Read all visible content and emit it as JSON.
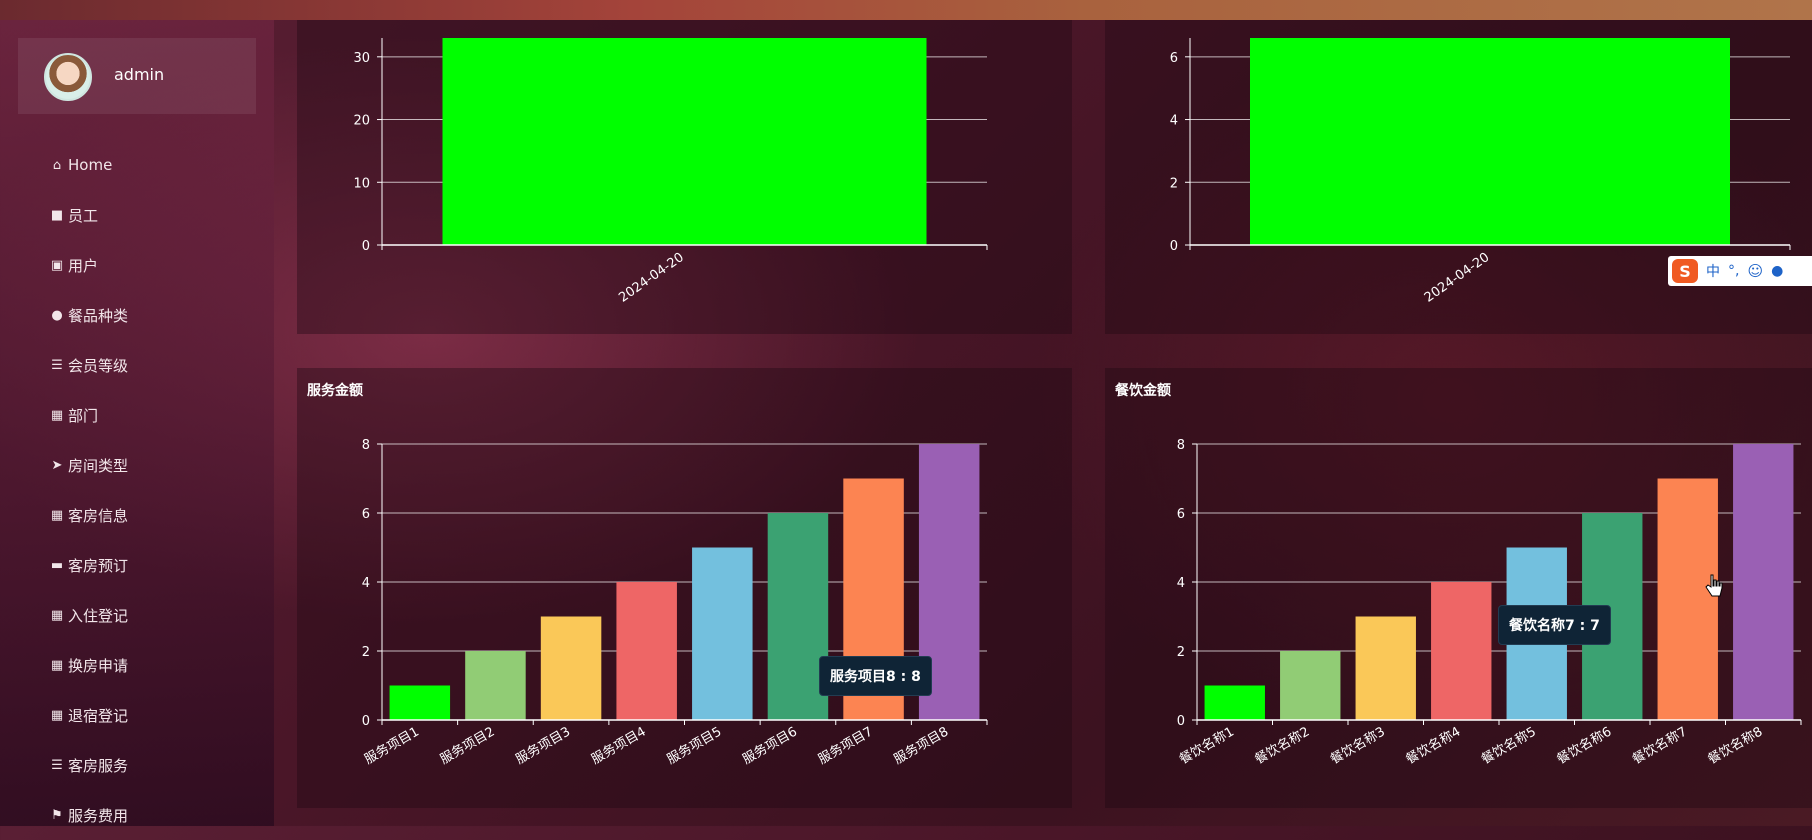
{
  "user": {
    "name": "admin"
  },
  "menu": [
    {
      "label": "Home",
      "icon": "home-icon",
      "glyph": "⌂",
      "active": true
    },
    {
      "label": "员工",
      "icon": "briefcase-icon",
      "glyph": "■"
    },
    {
      "label": "用户",
      "icon": "clipboard-icon",
      "glyph": "▣"
    },
    {
      "label": "餐品种类",
      "icon": "person-icon",
      "glyph": "●"
    },
    {
      "label": "会员等级",
      "icon": "sliders-icon",
      "glyph": "☰"
    },
    {
      "label": "部门",
      "icon": "grid-icon",
      "glyph": "▦"
    },
    {
      "label": "房间类型",
      "icon": "send-icon",
      "glyph": "➤"
    },
    {
      "label": "客房信息",
      "icon": "grid-icon",
      "glyph": "▦"
    },
    {
      "label": "客房预订",
      "icon": "monitor-icon",
      "glyph": "▬"
    },
    {
      "label": "入住登记",
      "icon": "apps-icon",
      "glyph": "▦"
    },
    {
      "label": "换房申请",
      "icon": "grid-icon",
      "glyph": "▦"
    },
    {
      "label": "退宿登记",
      "icon": "grid-icon",
      "glyph": "▦"
    },
    {
      "label": "客房服务",
      "icon": "list-icon",
      "glyph": "☰"
    },
    {
      "label": "服务费用",
      "icon": "flag-icon",
      "glyph": "⚑"
    }
  ],
  "chart_data": [
    {
      "type": "bar",
      "title": "",
      "categories": [
        "2024-04-20"
      ],
      "values": [
        33
      ],
      "yticks": [
        0,
        10,
        20,
        30
      ],
      "ylim": [
        0,
        33
      ],
      "colors": [
        "#00ff00"
      ],
      "grid": true
    },
    {
      "type": "bar",
      "title": "",
      "categories": [
        "2024-04-20"
      ],
      "values": [
        6.6
      ],
      "yticks": [
        0,
        2,
        4,
        6
      ],
      "ylim": [
        0,
        6.6
      ],
      "colors": [
        "#00ff00"
      ],
      "grid": true
    },
    {
      "type": "bar",
      "title": "服务金额",
      "categories": [
        "服务项目1",
        "服务项目2",
        "服务项目3",
        "服务项目4",
        "服务项目5",
        "服务项目6",
        "服务项目7",
        "服务项目8"
      ],
      "values": [
        1,
        2,
        3,
        4,
        5,
        6,
        7,
        8
      ],
      "yticks": [
        0,
        2,
        4,
        6,
        8
      ],
      "ylim": [
        0,
        8
      ],
      "colors": [
        "#00ff00",
        "#91cc75",
        "#fac858",
        "#ee6666",
        "#73c0de",
        "#3ba272",
        "#fc8452",
        "#9a60b4"
      ],
      "grid": true,
      "tooltip": "服务项目8 : 8"
    },
    {
      "type": "bar",
      "title": "餐饮金额",
      "categories": [
        "餐饮名称1",
        "餐饮名称2",
        "餐饮名称3",
        "餐饮名称4",
        "餐饮名称5",
        "餐饮名称6",
        "餐饮名称7",
        "餐饮名称8"
      ],
      "values": [
        1,
        2,
        3,
        4,
        5,
        6,
        7,
        8
      ],
      "yticks": [
        0,
        2,
        4,
        6,
        8
      ],
      "ylim": [
        0,
        8
      ],
      "colors": [
        "#00ff00",
        "#91cc75",
        "#fac858",
        "#ee6666",
        "#73c0de",
        "#3ba272",
        "#fc8452",
        "#9a60b4"
      ],
      "grid": true,
      "tooltip": "餐饮名称7 : 7"
    }
  ],
  "ime": {
    "logo": "S",
    "mode": "中",
    "punct": "°,"
  }
}
